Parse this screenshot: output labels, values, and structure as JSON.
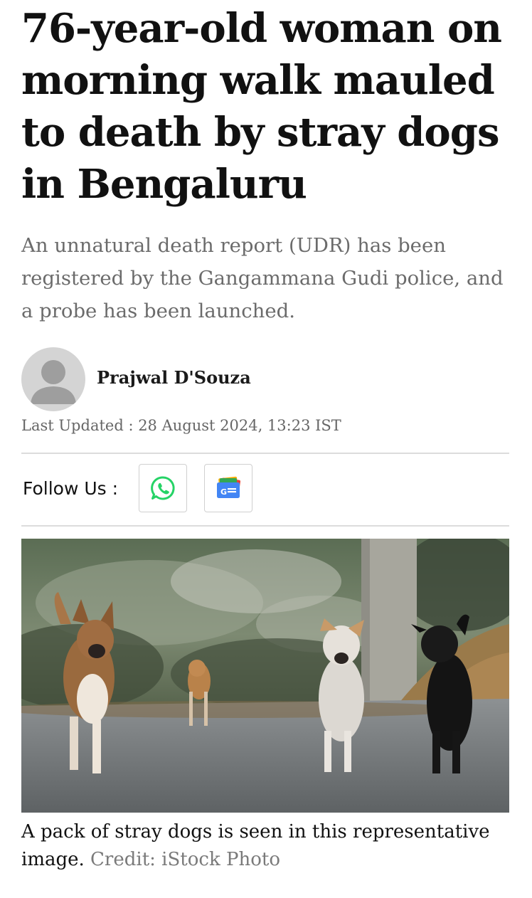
{
  "article": {
    "headline": "76-year-old woman on morning walk mauled to death by stray dogs in Bengaluru",
    "summary": "An unnatural death report (UDR) has been registered by the Gangammana Gudi police, and a probe has been launched.",
    "author_name": "Prajwal D'Souza",
    "last_updated": "Last Updated : 28 August 2024, 13:23 IST"
  },
  "follow": {
    "label": "Follow Us :",
    "buttons": [
      {
        "icon": "whatsapp-icon",
        "color": "#25D366"
      },
      {
        "icon": "google-news-icon",
        "color": "#4285F4"
      }
    ]
  },
  "image": {
    "caption": "A pack of stray dogs is seen in this representative image.",
    "credit": "Credit: iStock Photo"
  }
}
